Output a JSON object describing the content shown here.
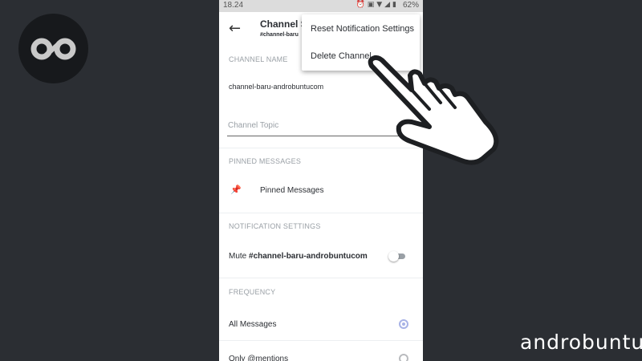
{
  "status_bar": {
    "time": "18.24",
    "battery": "62%",
    "icons": [
      "alarm-icon",
      "vibrate-icon",
      "wifi-icon",
      "signal-icon",
      "battery-icon"
    ]
  },
  "header": {
    "title": "Channel S",
    "subtitle": "#channel-baru"
  },
  "menu": {
    "items": [
      {
        "label": "Reset Notification Settings"
      },
      {
        "label": "Delete Channel"
      }
    ]
  },
  "channel_name": {
    "section_label": "CHANNEL NAME",
    "value": "channel-baru-androbuntucom"
  },
  "channel_topic": {
    "placeholder": "Channel Topic"
  },
  "pinned": {
    "section_label": "PINNED MESSAGES",
    "item_label": "Pinned Messages"
  },
  "notifications": {
    "section_label": "NOTIFICATION SETTINGS",
    "mute_prefix": "Mute ",
    "mute_channel": "#channel-baru-androbuntucom",
    "mute_enabled": false
  },
  "frequency": {
    "section_label": "FREQUENCY",
    "options": [
      {
        "label": "All Messages",
        "selected": true
      },
      {
        "label": "Only @mentions",
        "selected": false
      }
    ]
  },
  "watermark": {
    "text": "androbuntu"
  },
  "colors": {
    "background": "#2b2e33",
    "accent": "#a8b3e6",
    "muted_text": "#9aa0a6"
  }
}
